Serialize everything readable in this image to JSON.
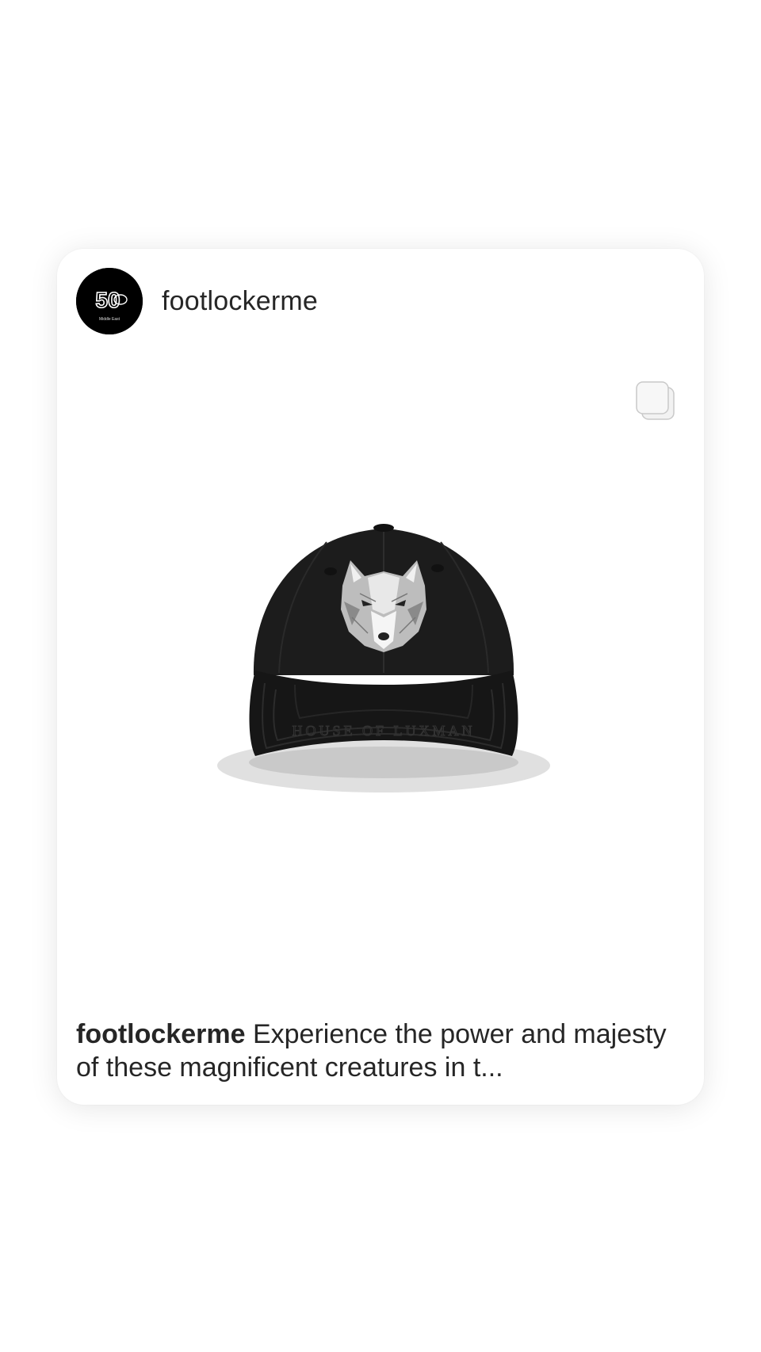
{
  "post": {
    "username": "footlockerme",
    "avatar": {
      "logo_text": "50",
      "logo_subtext": "Middle East"
    },
    "caption": {
      "username": "footlockerme",
      "text": "Experience the power and majesty of these magnificent creatures in t..."
    },
    "media": {
      "type": "carousel",
      "subject": "black baseball cap with embroidered wolf head",
      "cap_brim_text": "HOUSE OF LUXMAN"
    }
  },
  "colors": {
    "background": "#ffffff",
    "text": "#262626",
    "avatar_bg": "#000000",
    "cap": "#1c1c1c"
  },
  "icons": {
    "carousel": "multiple-photos-icon"
  }
}
